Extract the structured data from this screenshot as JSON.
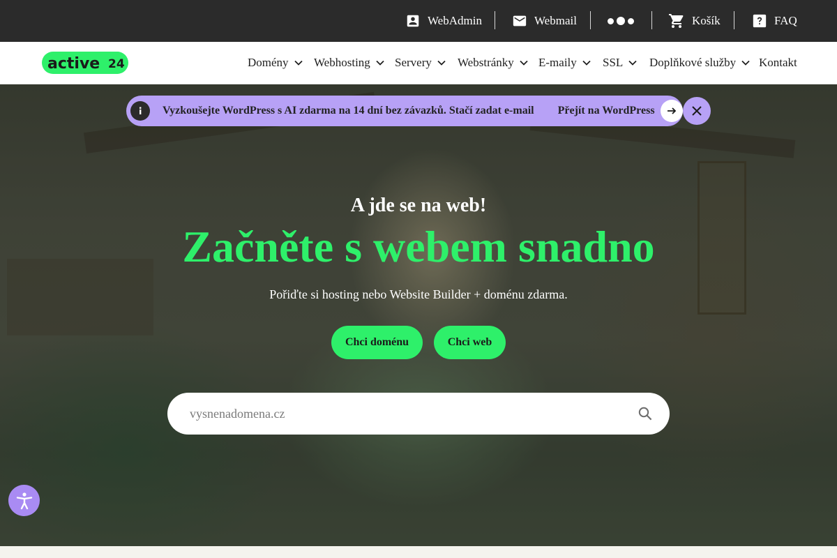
{
  "topbar": {
    "webadmin": {
      "label": "WebAdmin",
      "icon": "account-box-icon"
    },
    "webmail": {
      "label": "Webmail",
      "icon": "mail-icon"
    },
    "more": {
      "icon": "more-dots-icon"
    },
    "cart": {
      "label": "Košík",
      "icon": "cart-icon"
    },
    "faq": {
      "label": "FAQ",
      "icon": "help-icon"
    }
  },
  "brand": {
    "name": "active",
    "number": "24",
    "color": "#2ef06a"
  },
  "nav": {
    "items": [
      {
        "label": "Domény",
        "dropdown": true
      },
      {
        "label": "Webhosting",
        "dropdown": true
      },
      {
        "label": "Servery",
        "dropdown": true
      },
      {
        "label": "Webstránky",
        "dropdown": true
      },
      {
        "label": "E-maily",
        "dropdown": true
      },
      {
        "label": "SSL",
        "dropdown": true
      },
      {
        "label": "Doplňkové služby",
        "dropdown": true
      },
      {
        "label": "Kontakt",
        "dropdown": false
      }
    ]
  },
  "banner": {
    "text": "Vyzkoušejte WordPress s AI zdarma na 14 dní bez závazků. Stačí zadat e-mail",
    "link_label": "Přejít na WordPress",
    "color": "#b7a1f6"
  },
  "hero": {
    "eyebrow": "A jde se na web!",
    "headline": "Začněte s webem snadno",
    "subline": "Pořiďte si hosting nebo Website Builder + doménu zdarma.",
    "accent_color": "#2ef06a"
  },
  "buttons": {
    "domain": "Chci doménu",
    "web": "Chci web"
  },
  "search": {
    "placeholder": "vysnenadomena.cz",
    "value": ""
  },
  "accessibility": {
    "icon": "accessibility-icon"
  }
}
